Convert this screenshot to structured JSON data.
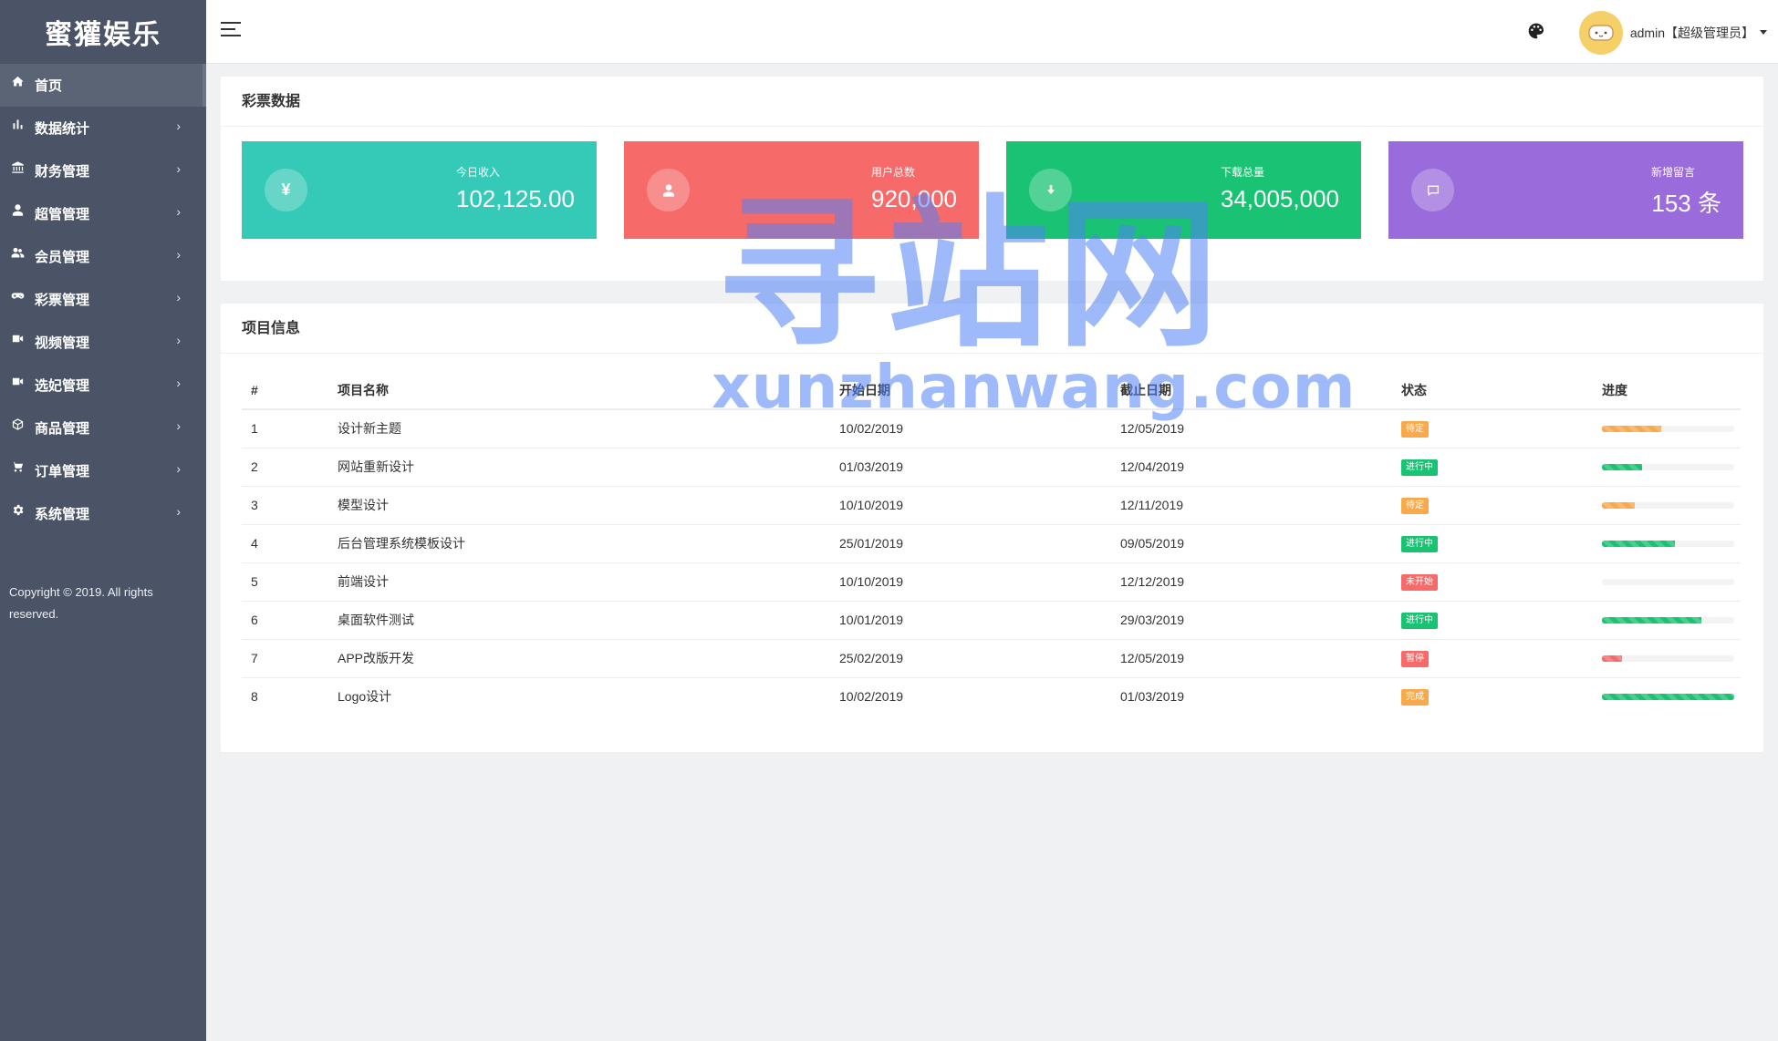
{
  "app": {
    "brand": "蜜獾娱乐"
  },
  "sidebar": {
    "items": [
      {
        "label": "首页",
        "icon": "home-icon",
        "active": true,
        "arrow": ""
      },
      {
        "label": "数据统计",
        "icon": "bar-chart-icon",
        "arrow": "›"
      },
      {
        "label": "财务管理",
        "icon": "bank-icon",
        "arrow": "›"
      },
      {
        "label": "超管管理",
        "icon": "user-icon",
        "arrow": "›"
      },
      {
        "label": "会员管理",
        "icon": "users-icon",
        "arrow": "›"
      },
      {
        "label": "彩票管理",
        "icon": "gamepad-icon",
        "arrow": "›"
      },
      {
        "label": "视频管理",
        "icon": "video-icon",
        "arrow": "›"
      },
      {
        "label": "选妃管理",
        "icon": "camera-icon",
        "arrow": "›"
      },
      {
        "label": "商品管理",
        "icon": "box-icon",
        "arrow": "›"
      },
      {
        "label": "订单管理",
        "icon": "cart-icon",
        "arrow": "›"
      },
      {
        "label": "系统管理",
        "icon": "gear-icon",
        "arrow": "›"
      }
    ],
    "copyright": "Copyright © 2019. All rights reserved."
  },
  "topbar": {
    "user": "admin【超级管理员】"
  },
  "lottery": {
    "title": "彩票数据",
    "cards": [
      {
        "label": "今日收入",
        "value": "102,125.00",
        "color": "#35c9b7",
        "icon": "yen-icon",
        "glyph": "¥"
      },
      {
        "label": "用户总数",
        "value": "920,000",
        "color": "#f66a6a",
        "icon": "user-icon",
        "glyph": ""
      },
      {
        "label": "下载总量",
        "value": "34,005,000",
        "color": "#19c373",
        "icon": "download-icon",
        "glyph": ""
      },
      {
        "label": "新增留言",
        "value": "153 条",
        "color": "#9a6bdb",
        "icon": "comment-icon",
        "glyph": ""
      }
    ]
  },
  "projects": {
    "title": "项目信息",
    "headers": [
      "#",
      "项目名称",
      "开始日期",
      "截止日期",
      "状态",
      "进度"
    ],
    "rows": [
      {
        "no": "1",
        "name": "设计新主题",
        "start": "10/02/2019",
        "end": "12/05/2019",
        "status": "待定",
        "status_color": "#f8a94b",
        "progress": 45,
        "bar_color": "#f8a94b"
      },
      {
        "no": "2",
        "name": "网站重新设计",
        "start": "01/03/2019",
        "end": "12/04/2019",
        "status": "进行中",
        "status_color": "#19c373",
        "progress": 30,
        "bar_color": "#19c373"
      },
      {
        "no": "3",
        "name": "模型设计",
        "start": "10/10/2019",
        "end": "12/11/2019",
        "status": "待定",
        "status_color": "#f8a94b",
        "progress": 25,
        "bar_color": "#f8a94b"
      },
      {
        "no": "4",
        "name": "后台管理系统模板设计",
        "start": "25/01/2019",
        "end": "09/05/2019",
        "status": "进行中",
        "status_color": "#19c373",
        "progress": 55,
        "bar_color": "#19c373"
      },
      {
        "no": "5",
        "name": "前端设计",
        "start": "10/10/2019",
        "end": "12/12/2019",
        "status": "未开始",
        "status_color": "#f66a6a",
        "progress": 0,
        "bar_color": "#f66a6a"
      },
      {
        "no": "6",
        "name": "桌面软件测试",
        "start": "10/01/2019",
        "end": "29/03/2019",
        "status": "进行中",
        "status_color": "#19c373",
        "progress": 75,
        "bar_color": "#19c373"
      },
      {
        "no": "7",
        "name": "APP改版开发",
        "start": "25/02/2019",
        "end": "12/05/2019",
        "status": "暂停",
        "status_color": "#f66a6a",
        "progress": 15,
        "bar_color": "#f66a6a"
      },
      {
        "no": "8",
        "name": "Logo设计",
        "start": "10/02/2019",
        "end": "01/03/2019",
        "status": "完成",
        "status_color": "#f8a94b",
        "progress": 100,
        "bar_color": "#19c373"
      }
    ]
  },
  "watermark": {
    "line1": "寻站网",
    "line2": "xunzhanwang.com"
  }
}
